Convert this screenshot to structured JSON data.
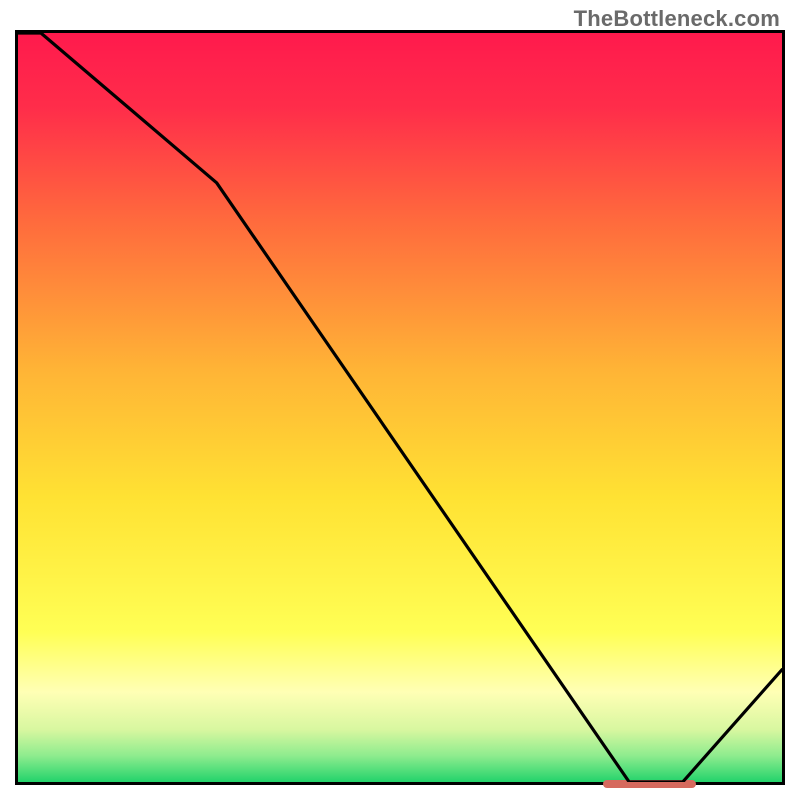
{
  "watermark": "TheBottleneck.com",
  "chart_data": {
    "type": "line",
    "title": "",
    "xlabel": "",
    "ylabel": "",
    "xlim": [
      0,
      100
    ],
    "ylim": [
      0,
      100
    ],
    "series": [
      {
        "name": "curve",
        "x": [
          0,
          3,
          26,
          80,
          87,
          100
        ],
        "values": [
          100,
          100,
          80,
          0,
          0,
          15
        ]
      }
    ],
    "marker": {
      "x_start": 76,
      "x_end": 88,
      "y": 0.5,
      "color": "#d66a5e"
    },
    "gradient_stops": [
      {
        "pos": 0.0,
        "color": "#ff1a4d"
      },
      {
        "pos": 0.1,
        "color": "#ff2d4a"
      },
      {
        "pos": 0.25,
        "color": "#ff6a3d"
      },
      {
        "pos": 0.45,
        "color": "#ffb436"
      },
      {
        "pos": 0.62,
        "color": "#ffe233"
      },
      {
        "pos": 0.8,
        "color": "#ffff55"
      },
      {
        "pos": 0.88,
        "color": "#ffffb5"
      },
      {
        "pos": 0.93,
        "color": "#d8f7a0"
      },
      {
        "pos": 0.965,
        "color": "#8eec8e"
      },
      {
        "pos": 1.0,
        "color": "#23d36b"
      }
    ]
  }
}
